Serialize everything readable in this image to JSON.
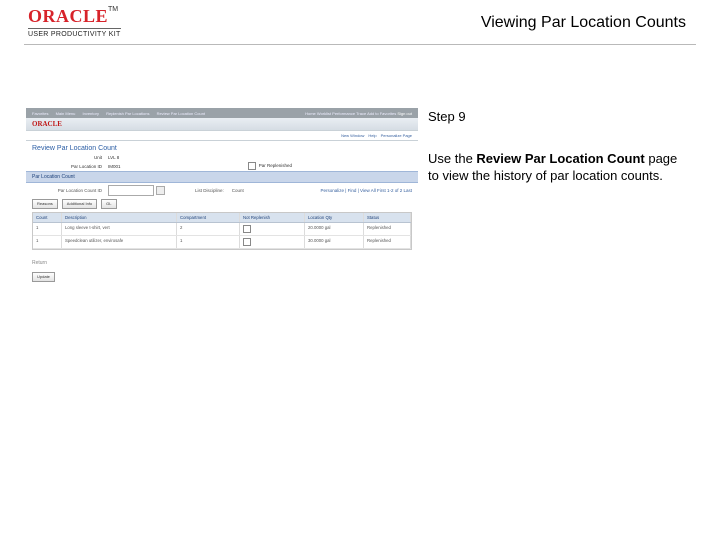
{
  "header": {
    "logo_word": "ORACLE",
    "logo_tm": "TM",
    "logo_sub": "USER PRODUCTIVITY KIT",
    "title": "Viewing Par Location Counts"
  },
  "instruction": {
    "step": "Step 9",
    "body_pre": "Use the ",
    "body_bold": "Review Par Location Count",
    "body_post": " page to view the history of par location counts."
  },
  "shot": {
    "topnav": {
      "left": "Favorites",
      "tabs": [
        "Main Menu",
        "Inventory",
        "Replenish Par Locations",
        "Review Par Location Count"
      ],
      "right": [
        "Home",
        "Worklist",
        "Performance Trace",
        "Add to Favorites"
      ],
      "signout": "Sign out"
    },
    "logo": "ORACLE",
    "subnav": {
      "new": "New Window",
      "help": "Help",
      "pers": "Personalize Page"
    },
    "page_title": "Review Par Location Count",
    "unit": {
      "label": "Unit",
      "value": "LVL 8"
    },
    "par_loc": {
      "label": "Par Location ID",
      "value": "IM001"
    },
    "par_replen": {
      "label": "Par Replenished"
    },
    "bluebar_label": "Par Location Count",
    "filter": {
      "label": "Par Location Count ID",
      "placeholder": ""
    },
    "list_sep": "List Discipline:",
    "count_lab": "Count",
    "pager": "Personalize | Find | View All  First  1-2 of 2  Last",
    "btn_reasons": "Reasons",
    "btn_addl": "Additional Info",
    "icon_btn": "GL",
    "th": {
      "c1": "Count",
      "c2": "Description",
      "c3": "Compartment",
      "c4": "Not Replenish",
      "c5": "Location Qty",
      "c6": "Status"
    },
    "rows": [
      {
        "c1": "1",
        "c2": "Long sleeve t-shirt, vert",
        "c3": "2",
        "c5": "20.0000  gal",
        "c6": "Replenished"
      },
      {
        "c1": "1",
        "c2": "Speedclean utilizer, envirosafe",
        "c3": "1",
        "c5": "30.0000  gal",
        "c6": "Replenished"
      }
    ],
    "return": "Return",
    "update": "Update"
  }
}
